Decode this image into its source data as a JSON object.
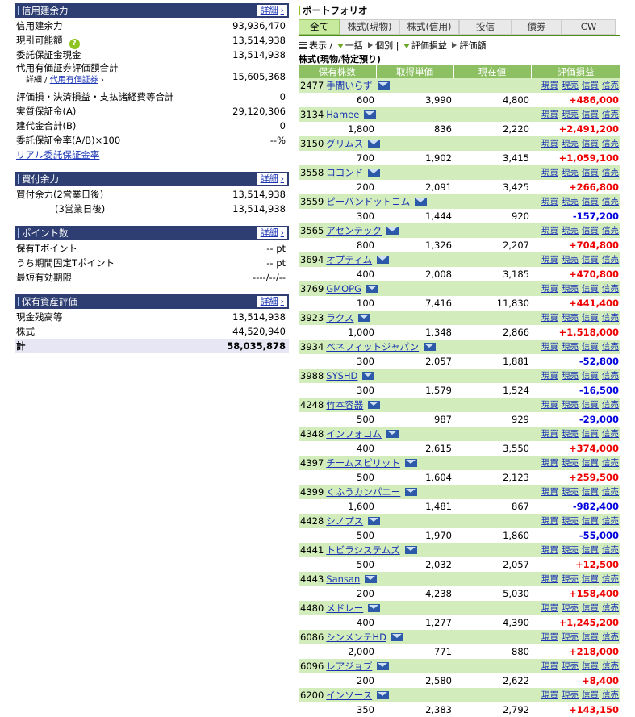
{
  "left": {
    "margin": {
      "title": "信用建余力",
      "detail": "詳細",
      "rows": [
        {
          "label": "信用建余力",
          "value": "93,936,470"
        },
        {
          "label": "現引可能額",
          "value": "13,514,938"
        },
        {
          "label": "委託保証金現金",
          "value": "13,514,938"
        },
        {
          "label": "代用有価証券評価額合計",
          "value": "15,605,368"
        },
        {
          "label": "評価損・決済損益・支払諸経費等合計",
          "value": "0"
        },
        {
          "label": "実質保証金(A)",
          "value": "29,120,306"
        },
        {
          "label": "建代金合計(B)",
          "value": "0"
        },
        {
          "label": "委託保証金率(A/B)×100",
          "value": "--%"
        }
      ],
      "sub_prefix": "詳細 / ",
      "sub_link": "代用有価証券",
      "rate_link": "リアル委託保証金率"
    },
    "buying": {
      "title": "買付余力",
      "detail": "詳細",
      "rows": [
        {
          "label": "買付余力(2営業日後)",
          "value": "13,514,938"
        },
        {
          "label": "(3営業日後)",
          "value": "13,514,938"
        }
      ]
    },
    "points": {
      "title": "ポイント数",
      "detail": "詳細",
      "rows": [
        {
          "label": "保有Tポイント",
          "value": "-- pt"
        },
        {
          "label": "うち期間固定Tポイント",
          "value": "-- pt"
        },
        {
          "label": "最短有効期限",
          "value": "----/--/--"
        }
      ]
    },
    "assets": {
      "title": "保有資産評価",
      "detail": "詳細",
      "rows": [
        {
          "label": "現金残高等",
          "value": "13,514,938"
        },
        {
          "label": "株式",
          "value": "44,520,940"
        }
      ],
      "total": {
        "label": "計",
        "value": "58,035,878"
      }
    }
  },
  "right": {
    "title": "ポートフォリオ",
    "tabs": [
      "全て",
      "株式(現物)",
      "株式(信用)",
      "投信",
      "債券",
      "CW"
    ],
    "toolbar": {
      "display": "表示",
      "collapse": "一括",
      "individual": "個別",
      "gain": "評価損益",
      "amount": "評価額"
    },
    "section_title": "株式(現物/特定預り)",
    "columns": [
      "保有株数",
      "取得単価",
      "現在値",
      "評価損益"
    ],
    "actions": [
      "現買",
      "現売",
      "信買",
      "信売"
    ],
    "holdings": [
      {
        "code": "2477",
        "name": "手間いらず",
        "qty": "600",
        "cost": "3,990",
        "price": "4,800",
        "pl": "+486,000"
      },
      {
        "code": "3134",
        "name": "Hamee",
        "qty": "1,800",
        "cost": "836",
        "price": "2,220",
        "pl": "+2,491,200"
      },
      {
        "code": "3150",
        "name": "グリムス",
        "qty": "700",
        "cost": "1,902",
        "price": "3,415",
        "pl": "+1,059,100"
      },
      {
        "code": "3558",
        "name": "ロコンド",
        "qty": "200",
        "cost": "2,091",
        "price": "3,425",
        "pl": "+266,800"
      },
      {
        "code": "3559",
        "name": "ピーバンドットコム",
        "qty": "300",
        "cost": "1,444",
        "price": "920",
        "pl": "-157,200"
      },
      {
        "code": "3565",
        "name": "アセンテック",
        "qty": "800",
        "cost": "1,326",
        "price": "2,207",
        "pl": "+704,800"
      },
      {
        "code": "3694",
        "name": "オプティム",
        "qty": "400",
        "cost": "2,008",
        "price": "3,185",
        "pl": "+470,800"
      },
      {
        "code": "3769",
        "name": "GMOPG",
        "qty": "100",
        "cost": "7,416",
        "price": "11,830",
        "pl": "+441,400"
      },
      {
        "code": "3923",
        "name": "ラクス",
        "qty": "1,000",
        "cost": "1,348",
        "price": "2,866",
        "pl": "+1,518,000"
      },
      {
        "code": "3934",
        "name": "ベネフィットジャパン",
        "qty": "300",
        "cost": "2,057",
        "price": "1,881",
        "pl": "-52,800"
      },
      {
        "code": "3988",
        "name": "SYSHD",
        "qty": "300",
        "cost": "1,579",
        "price": "1,524",
        "pl": "-16,500"
      },
      {
        "code": "4248",
        "name": "竹本容器",
        "qty": "500",
        "cost": "987",
        "price": "929",
        "pl": "-29,000"
      },
      {
        "code": "4348",
        "name": "インフォコム",
        "qty": "400",
        "cost": "2,615",
        "price": "3,550",
        "pl": "+374,000"
      },
      {
        "code": "4397",
        "name": "チームスピリット",
        "qty": "500",
        "cost": "1,604",
        "price": "2,123",
        "pl": "+259,500"
      },
      {
        "code": "4399",
        "name": "くふうカンパニー",
        "qty": "1,600",
        "cost": "1,481",
        "price": "867",
        "pl": "-982,400"
      },
      {
        "code": "4428",
        "name": "シノプス",
        "qty": "500",
        "cost": "1,970",
        "price": "1,860",
        "pl": "-55,000"
      },
      {
        "code": "4441",
        "name": "トビラシステムズ",
        "qty": "500",
        "cost": "2,032",
        "price": "2,057",
        "pl": "+12,500"
      },
      {
        "code": "4443",
        "name": "Sansan",
        "qty": "200",
        "cost": "4,238",
        "price": "5,030",
        "pl": "+158,400"
      },
      {
        "code": "4480",
        "name": "メドレー",
        "qty": "400",
        "cost": "1,277",
        "price": "4,390",
        "pl": "+1,245,200"
      },
      {
        "code": "6086",
        "name": "シンメンテHD",
        "qty": "2,000",
        "cost": "771",
        "price": "880",
        "pl": "+218,000"
      },
      {
        "code": "6096",
        "name": "レアジョブ",
        "qty": "200",
        "cost": "2,580",
        "price": "2,622",
        "pl": "+8,400"
      },
      {
        "code": "6200",
        "name": "インソース",
        "qty": "350",
        "cost": "2,383",
        "price": "2,792",
        "pl": "+143,150"
      }
    ]
  }
}
